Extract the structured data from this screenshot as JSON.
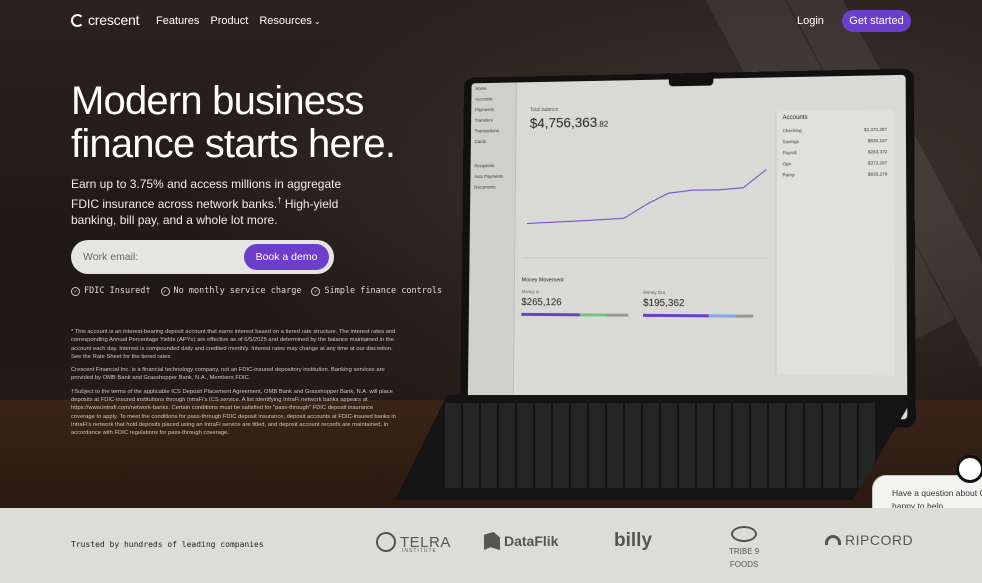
{
  "nav": {
    "logo": "crescent",
    "links": [
      "Features",
      "Product",
      "Resources"
    ],
    "login": "Login",
    "cta": "Get started"
  },
  "hero": {
    "headline": "Modern business finance starts here.",
    "subcopy_main": "Earn up to 3.75% and access millions in aggregate FDIC insurance across network banks.",
    "subcopy_sup": "†",
    "subcopy_tail": " High-yield banking, bill pay, and a whole lot more.",
    "email_placeholder": "Work email:",
    "demo_button": "Book a demo",
    "features": [
      "FDIC Insured†",
      "No monthly service charge",
      "Simple finance controls"
    ]
  },
  "disclaimer": {
    "p1": "* This account is an interest-bearing deposit account that earns interest based on a tiered rate structure. The interest rates and corresponding Annual Percentage Yields (APYs) are effective as of 6/5/2025 and determined by the balance maintained in the account each day. Interest is compounded daily and credited monthly. Interest rates may change at any time at our discretion. See the Rate Sheet for the tiered rates.",
    "p2": "Crescent Financial Inc. is a financial technology company, not an FDIC-insured depository institution. Banking services are provided by OMB Bank and Grasshopper Bank, N.A., Members FDIC.",
    "p3": "†Subject to the terms of the applicable ICS Deposit Placement Agreement, OMB Bank and Grasshopper Bank, N.A. will place deposits at FDIC-insured institutions through IntraFi's ICS service. A list identifying IntraFi network banks appears at https://www.intrafi.com/network-banks. Certain conditions must be satisfied for \"pass-through\" FDIC deposit insurance coverage to apply. To meet the conditions for pass-through FDIC deposit insurance, deposit accounts at FDIC-insured banks in IntraFi's network that hold deposits placed using an IntraFi service are titled, and deposit account records are maintained, in accordance with FDIC regulations for pass-through coverage."
  },
  "laptop": {
    "sidebar": [
      "Home",
      "Accounts",
      "Payments",
      "Transfers",
      "Transactions",
      "Cards",
      "Recipients",
      "Auto Payments",
      "Documents"
    ],
    "balance_label": "Total balance",
    "balance": "$4,756,363",
    "balance_cents": ".82",
    "accounts_title": "Accounts",
    "accounts": [
      {
        "name": "Checking",
        "value": "$2,372,287"
      },
      {
        "name": "Savings",
        "value": "$830,167"
      },
      {
        "name": "Payroll",
        "value": "$263,372"
      },
      {
        "name": "Ops",
        "value": "$372,287"
      },
      {
        "name": "Ramp",
        "value": "$833,278"
      }
    ],
    "money_movement": "Money Movement",
    "money_in_label": "Money in",
    "money_in": "$265,126",
    "money_out_label": "Money Out",
    "money_out": "$195,362"
  },
  "chat": {
    "text_line1": "Have a question about C",
    "text_line2": "happy to help."
  },
  "trust": {
    "label": "Trusted by hundreds of leading companies",
    "brands": {
      "telra": "TELRA",
      "telra_sub": "INSTITUTE",
      "dataflik": "DataFlik",
      "billy": "billy",
      "tribe_line1": "TRIBE 9",
      "tribe_line2": "FOODS",
      "ripcord": "RIPCORD"
    }
  }
}
